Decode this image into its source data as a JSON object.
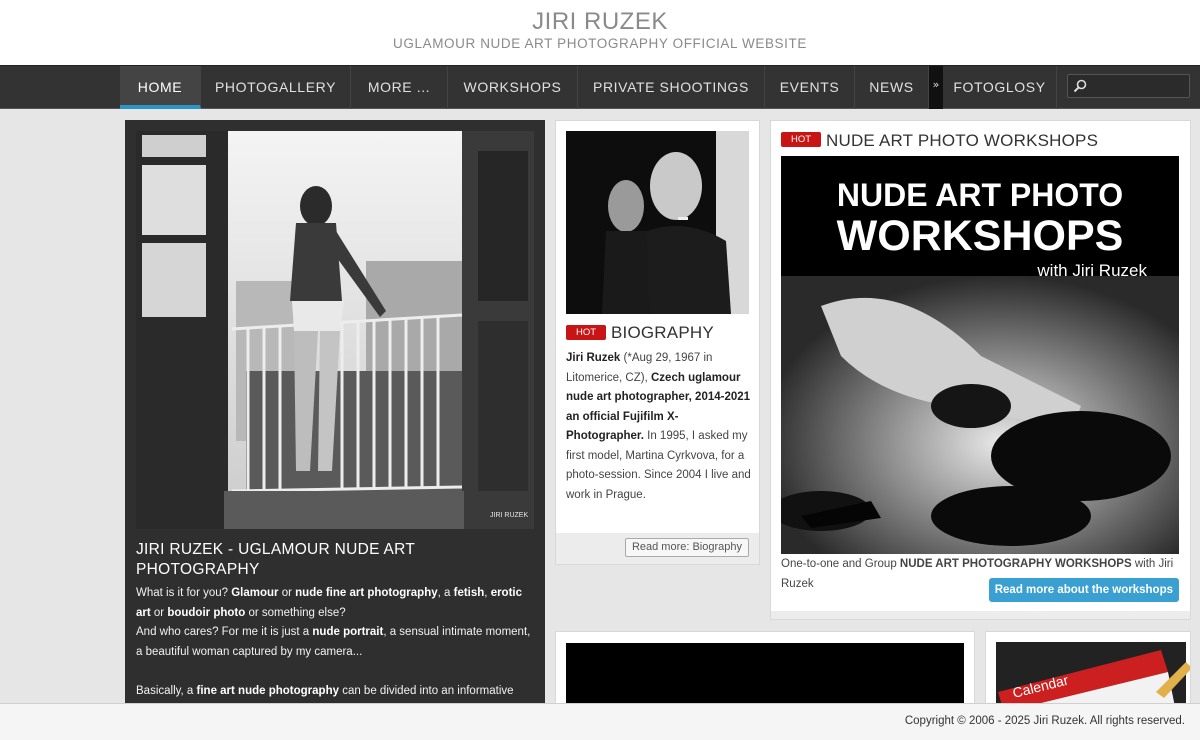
{
  "header": {
    "title": "JIRI RUZEK",
    "subtitle": "UGLAMOUR NUDE ART PHOTOGRAPHY OFFICIAL WEBSITE"
  },
  "nav": {
    "items": [
      {
        "label": "HOME"
      },
      {
        "label": "PHOTOGALLERY"
      },
      {
        "label": "MORE ..."
      },
      {
        "label": "WORKSHOPS"
      },
      {
        "label": "PRIVATE SHOOTINGS"
      },
      {
        "label": "EVENTS"
      },
      {
        "label": "NEWS"
      },
      {
        "label": "FOTOGLOSY"
      }
    ],
    "separator": "»",
    "search_placeholder": ""
  },
  "feature": {
    "watermark": "JIRI RUZEK",
    "title": "JIRI RUZEK - UGLAMOUR NUDE ART PHOTOGRAPHY",
    "p1_a": "What is it for you? ",
    "p1_b": "Glamour",
    "p1_c": " or ",
    "p1_d": "nude fine art photography",
    "p1_e": ", a ",
    "p1_f": "fetish",
    "p1_g": ", ",
    "p1_h": "erotic art",
    "p1_i": " or ",
    "p1_j": "boudoir photo",
    "p1_k": " or something else?",
    "p2_a": "And who cares? For me it is just a ",
    "p2_b": "nude portrait",
    "p2_c": ", a sensual intimate moment, a beautiful woman captured by my camera...",
    "p3_a": "Basically, a ",
    "p3_b": "fine art nude photography",
    "p3_c": " can be divided into an informative"
  },
  "bio": {
    "badge": "HOT",
    "title": "BIOGRAPHY",
    "t1": "Jiri Ruzek",
    "t2": " (*Aug 29, 1967 in Litomerice, CZ), ",
    "t3": "Czech uglamour nude art photographer, 2014-2021 an official Fujifilm X-Photographer.",
    "t4": " In 1995, I asked my first model, Martina Cyrkvova, for a photo-session. Since 2004 I live and work in Prague.",
    "read_more": "Read more: Biography"
  },
  "workshops": {
    "badge": "HOT",
    "title": "NUDE ART PHOTO WORKSHOPS",
    "banner_line1": "NUDE ART PHOTO",
    "banner_line2": "WORKSHOPS",
    "banner_line3": "with Jiri Ruzek",
    "caption_a": "One-to-one and Group ",
    "caption_b": "NUDE ART PHOTOGRAPHY WORKSHOPS",
    "caption_c": " with Jiri Ruzek",
    "button": "Read more about the workshops"
  },
  "calendar": {
    "label": "Calendar"
  },
  "footer": {
    "copyright": "Copyright © 2006 - 2025 Jiri Ruzek. All rights reserved."
  },
  "colors": {
    "accent": "#2a96c8",
    "hot": "#c81414",
    "button": "#3aa0d2",
    "nav_bg": "#333333"
  }
}
